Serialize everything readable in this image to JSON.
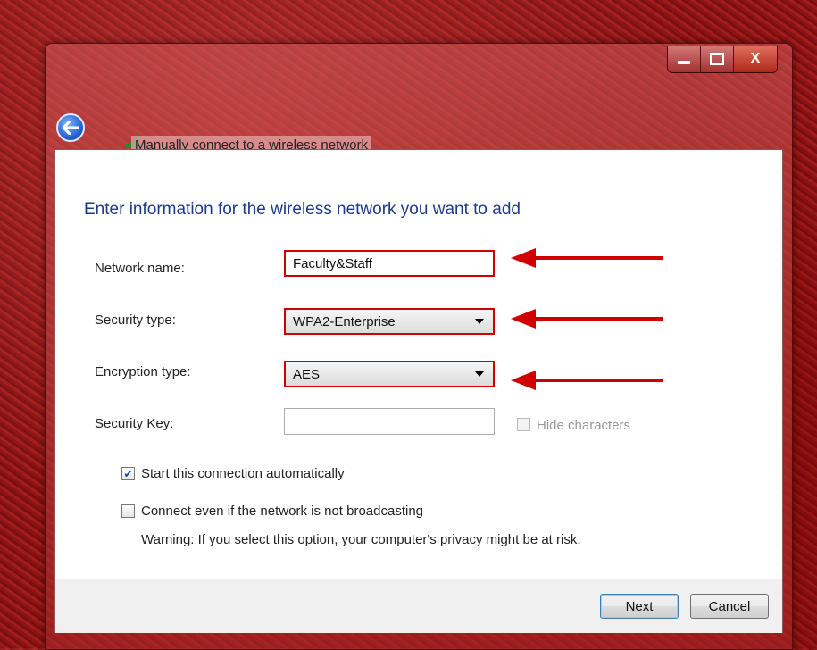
{
  "window": {
    "title": "Manually connect to a wireless network",
    "controls": {
      "minimize": "",
      "maximize": "",
      "close": "X"
    }
  },
  "heading": "Enter information for the wireless network you want to add",
  "form": {
    "network_name": {
      "label": "Network name:",
      "value": "Faculty&Staff"
    },
    "security_type": {
      "label": "Security type:",
      "value": "WPA2-Enterprise"
    },
    "encryption_type": {
      "label": "Encryption type:",
      "value": "AES"
    },
    "security_key": {
      "label": "Security Key:",
      "value": ""
    },
    "hide_characters": {
      "label": "Hide characters",
      "checked": false,
      "enabled": false
    }
  },
  "options": {
    "start_auto": {
      "label": "Start this connection automatically",
      "checked": true
    },
    "connect_hidden": {
      "label": "Connect even if the network is not broadcasting",
      "checked": false
    },
    "warning": "Warning: If you select this option, your computer's privacy might be at risk."
  },
  "buttons": {
    "next": "Next",
    "cancel": "Cancel"
  },
  "icons": {
    "back": "back-arrow-icon",
    "signal": "wireless-signal-icon",
    "annotation_arrow": "red-arrow-icon",
    "check": "checkmark-icon",
    "caret": "chevron-down-icon"
  },
  "colors": {
    "heading": "#1e3a8a",
    "annotation": "#d00000",
    "background": "#941818"
  }
}
